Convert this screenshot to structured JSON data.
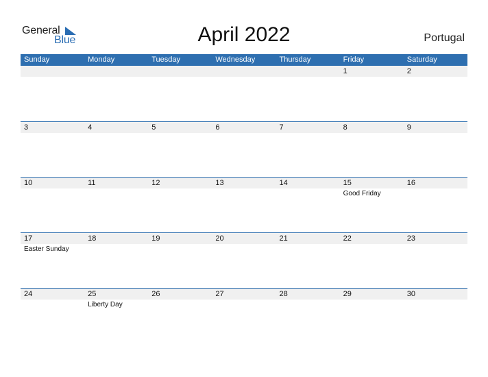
{
  "logo": {
    "line1": "General",
    "line2": "Blue"
  },
  "title": "April 2022",
  "country": "Portugal",
  "colors": {
    "accent": "#2e6fb0",
    "strip": "#f0f0f0"
  },
  "weekdays": [
    "Sunday",
    "Monday",
    "Tuesday",
    "Wednesday",
    "Thursday",
    "Friday",
    "Saturday"
  ],
  "weeks": [
    {
      "days": [
        "",
        "",
        "",
        "",
        "",
        "1",
        "2"
      ],
      "events": [
        "",
        "",
        "",
        "",
        "",
        "",
        ""
      ]
    },
    {
      "days": [
        "3",
        "4",
        "5",
        "6",
        "7",
        "8",
        "9"
      ],
      "events": [
        "",
        "",
        "",
        "",
        "",
        "",
        ""
      ]
    },
    {
      "days": [
        "10",
        "11",
        "12",
        "13",
        "14",
        "15",
        "16"
      ],
      "events": [
        "",
        "",
        "",
        "",
        "",
        "Good Friday",
        ""
      ]
    },
    {
      "days": [
        "17",
        "18",
        "19",
        "20",
        "21",
        "22",
        "23"
      ],
      "events": [
        "Easter Sunday",
        "",
        "",
        "",
        "",
        "",
        ""
      ]
    },
    {
      "days": [
        "24",
        "25",
        "26",
        "27",
        "28",
        "29",
        "30"
      ],
      "events": [
        "",
        "Liberty Day",
        "",
        "",
        "",
        "",
        ""
      ]
    }
  ]
}
